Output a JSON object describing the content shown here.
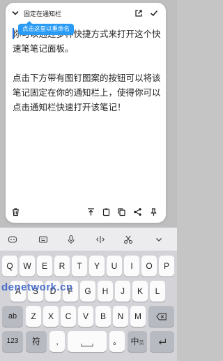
{
  "note": {
    "title": "固定在通知栏",
    "tooltip": "点击这里以重命名",
    "paragraphs": [
      "你可以通过多种快捷方式来打开这个快速笔笔记面板。",
      "点击下方带有图钉图案的按钮可以将该笔记固定在你的通知栏上，使得你可以点击通知栏快速打开该笔记！"
    ]
  },
  "keyboard": {
    "row1": [
      "Q",
      "W",
      "E",
      "R",
      "T",
      "Y",
      "U",
      "I",
      "O",
      "P"
    ],
    "row2": [
      "A",
      "S",
      "D",
      "F",
      "G",
      "H",
      "J",
      "K",
      "L"
    ],
    "row3": [
      "Z",
      "X",
      "C",
      "V",
      "B",
      "N",
      "M"
    ],
    "shift_label": "ab",
    "num_label": "123",
    "sym_label": "符",
    "comma_label": ",",
    "period_label": "。",
    "lang_label": "中",
    "lang_sub": "英"
  },
  "watermark": "denetwork.cn",
  "colors": {
    "accent": "#2a9bf5",
    "watermark": "#3b62c6"
  }
}
